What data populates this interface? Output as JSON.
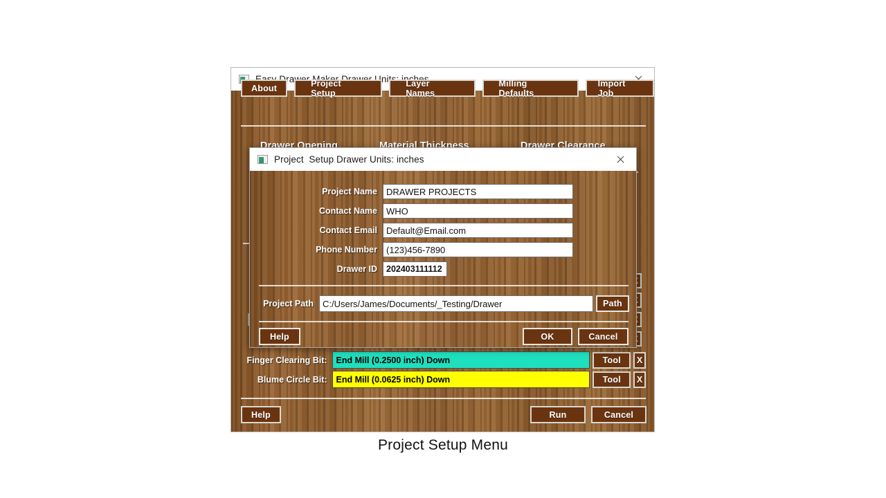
{
  "app": {
    "title": "Easy Drawer Maker Drawer Units: inches",
    "icon": "window-icon",
    "close_icon": "close-icon",
    "tabs": [
      {
        "label": "About"
      },
      {
        "label": "Project Setup"
      },
      {
        "label": "Layer Names"
      },
      {
        "label": "Milling Defaults"
      },
      {
        "label": "Import Job"
      }
    ],
    "column_headings": [
      {
        "label": "Drawer Opening"
      },
      {
        "label": "Material Thickness"
      },
      {
        "label": "Drawer Clearance"
      }
    ],
    "edge_buttons": [
      {
        "label": "X"
      },
      {
        "label": "X"
      },
      {
        "label": "X"
      },
      {
        "label": "X"
      }
    ],
    "bit_rows": [
      {
        "label": "Finger Clearing Bit:",
        "value": "End Mill (0.2500 inch) Down",
        "color": "#1fe0be",
        "tool_label": "Tool",
        "clear_label": "X"
      },
      {
        "label": "Blume Circle Bit:",
        "value": "End Mill (0.0625 inch) Down",
        "color": "#ffff00",
        "tool_label": "Tool",
        "clear_label": "X"
      }
    ],
    "footer": {
      "help_label": "Help",
      "run_label": "Run",
      "cancel_label": "Cancel"
    }
  },
  "dialog": {
    "title": "Project  Setup Drawer Units: inches",
    "icon": "window-icon",
    "close_icon": "close-icon",
    "fields": [
      {
        "label": "Project Name",
        "value": "DRAWER PROJECTS"
      },
      {
        "label": "Contact Name",
        "value": "WHO"
      },
      {
        "label": "Contact Email",
        "value": "Default@Email.com"
      },
      {
        "label": "Phone Number",
        "value": "(123)456-7890"
      },
      {
        "label": "Drawer ID",
        "value": "202403111112"
      }
    ],
    "path_row": {
      "label": "Project Path",
      "value": "C:/Users/James/Documents/_Testing/Drawer",
      "button_label": "Path"
    },
    "buttons": {
      "help_label": "Help",
      "ok_label": "OK",
      "cancel_label": "Cancel"
    }
  },
  "caption": {
    "text": "Project Setup Menu"
  },
  "colors": {
    "wood": "#91602f",
    "button_fill": "#6b3410",
    "button_border": "#d8d8d0",
    "finger_bit": "#1fe0be",
    "blume_bit": "#ffff00"
  }
}
